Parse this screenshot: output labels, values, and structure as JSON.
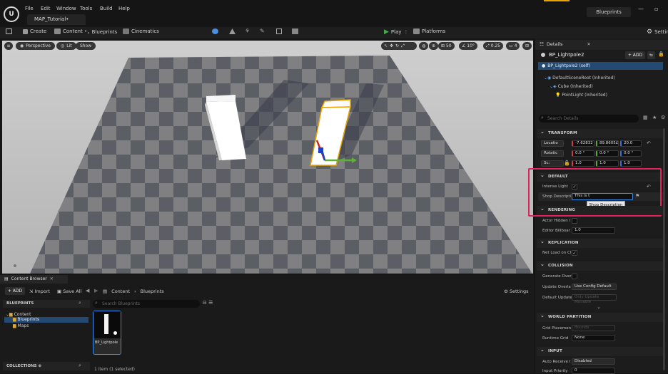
{
  "menu": {
    "file": "File",
    "edit": "Edit",
    "window": "Window",
    "tools": "Tools",
    "build": "Build",
    "help": "Help"
  },
  "level_tab": "MAP_Tutorial•",
  "blueprints_tab": "Blueprints",
  "toolbar": {
    "create": "Create",
    "content": "Content",
    "blueprints": "Blueprints",
    "cinematics": "Cinematics",
    "play": "Play",
    "platforms": "Platforms",
    "settings": "Settin"
  },
  "viewport": {
    "perspective": "Perspective",
    "lit": "Lit",
    "show": "Show",
    "grid": "50",
    "angle": "10°",
    "scale": "0.25",
    "cams": "4"
  },
  "details": {
    "tab": "Details",
    "object": "BP_Lightpole2",
    "add": "+ ADD",
    "self": "BP_Lightpole2 (self)",
    "tree": [
      "DefaultSceneRoot (Inherited)",
      "Cube (Inherited)",
      "PointLight (Inherited)"
    ],
    "search_placeholder": "Search Details",
    "sections": {
      "transform": "TRANSFORM",
      "default": "DEFAULT",
      "rendering": "RENDERING",
      "replication": "REPLICATION",
      "collision": "COLLISION",
      "world_partition": "WORLD PARTITION",
      "input": "INPUT"
    },
    "location": {
      "label": "Locatio",
      "x": "-7.62832",
      "y": "89.8605£",
      "z": "20.0"
    },
    "rotation": {
      "label": "Rotatic",
      "x": "0.0 °",
      "y": "0.0 °",
      "z": "0.0 °"
    },
    "scale": {
      "label": "Sc:",
      "x": "1.0",
      "y": "1.0",
      "z": "1.0"
    },
    "intense_light": {
      "label": "Intense Light",
      "check": "✓"
    },
    "shop_description": {
      "label": "Shop Descripti",
      "value": "This is t",
      "tooltip": "Shop Description"
    },
    "actor_hidden": "Actor Hidden I",
    "editor_billboard": {
      "label": "Editor Billboar",
      "value": "1.0"
    },
    "net_load": {
      "label": "Net Load on Cl",
      "check": "✓"
    },
    "generate_overlap": "Generate Over",
    "update_overlaps": {
      "label": "Update Overla",
      "value": "Use Config Default"
    },
    "default_update": {
      "label": "Default Update",
      "value": "Only Update Movable"
    },
    "grid_placement": {
      "label": "Grid Placemen",
      "value": "Bounds"
    },
    "runtime_grid": {
      "label": "Runtime Grid",
      "value": "None"
    },
    "auto_receive": {
      "label": "Auto Receive I",
      "value": "Disabled"
    },
    "input_priority": {
      "label": "Input Priority",
      "value": "0"
    }
  },
  "content_browser": {
    "tab": "Content Browser",
    "add": "+ ADD",
    "import": "Import",
    "save_all": "Save All",
    "path": [
      "Content",
      "Blueprints"
    ],
    "settings": "Settings",
    "section": "BLUEPRINTS",
    "tree": [
      "Content",
      "Blueprints",
      "Maps"
    ],
    "search_placeholder": "Search Blueprints",
    "asset": "BP_Lightpole",
    "collections": "COLLECTIONS",
    "status": "1 item (1 selected)"
  },
  "colors": {
    "accent": "#e8a400",
    "highlight_box": "#e0245e",
    "play": "#43b04a",
    "selection": "#0d6fd8"
  }
}
